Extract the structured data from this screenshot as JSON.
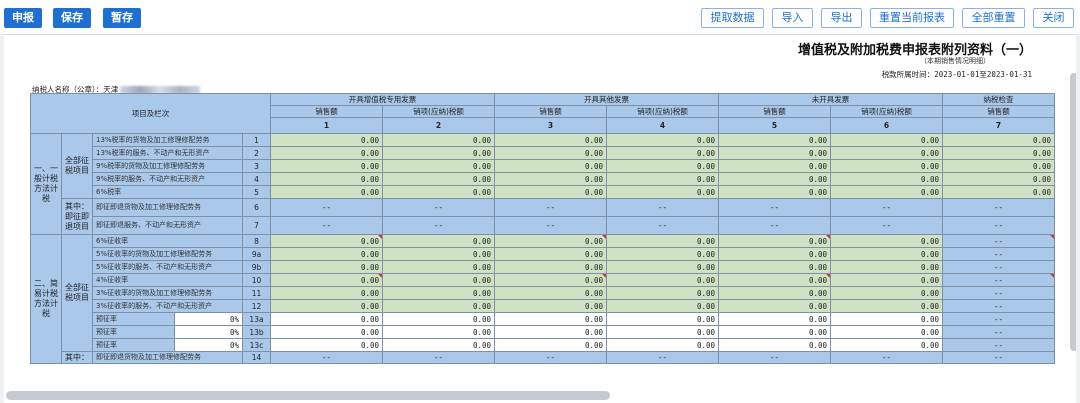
{
  "toolbar": {
    "declare": "申报",
    "save": "保存",
    "temp_save": "暂存",
    "fetch": "提取数据",
    "import": "导入",
    "export": "导出",
    "reset_current": "重置当前报表",
    "reset_all": "全部重置",
    "close": "关闭"
  },
  "report": {
    "title": "增值税及附加税费申报表附列资料（一）",
    "subtitle": "（本期销售情况明细）",
    "period_label": "税款所属时间：",
    "period_value": "2023-01-01至2023-01-31",
    "taxpayer_label": "纳税人名称（公章）：天津"
  },
  "table": {
    "item_header": "项目及栏次",
    "groups": [
      "开具增值税专用发票",
      "开具其他发票",
      "未开具发票",
      "纳税检查"
    ],
    "sub_sales": "销售额",
    "sub_tax": "销项(应纳)税额",
    "col_nums": [
      "1",
      "2",
      "3",
      "4",
      "5",
      "6",
      "7"
    ],
    "sec1": "一、一般计税方法计税",
    "sec2": "二、简易计税方法计税",
    "sub_all": "全部征税项目",
    "sub_refund": "其中：即征即退项目",
    "sub_refund_short": "其中：",
    "zero": "0.00",
    "dash": "--",
    "rate_pct": "0%",
    "rows": [
      {
        "label": "13%税率的货物及加工修理修配劳务",
        "ln": "1"
      },
      {
        "label": "13%税率的服务、不动产和无形资产",
        "ln": "2"
      },
      {
        "label": "9%税率的货物及加工修理修配劳务",
        "ln": "3"
      },
      {
        "label": "9%税率的服务、不动产和无形资产",
        "ln": "4"
      },
      {
        "label": "6%税率",
        "ln": "5"
      },
      {
        "label": "即征即退货物及加工修理修配劳务",
        "ln": "6"
      },
      {
        "label": "即征即退服务、不动产和无形资产",
        "ln": "7"
      },
      {
        "label": "6%征收率",
        "ln": "8"
      },
      {
        "label": "5%征收率的货物及加工修理修配劳务",
        "ln": "9a"
      },
      {
        "label": "5%征收率的服务、不动产和无形资产",
        "ln": "9b"
      },
      {
        "label": "4%征收率",
        "ln": "10"
      },
      {
        "label": "3%征收率的货物及加工修理修配劳务",
        "ln": "11"
      },
      {
        "label": "3%征收率的服务、不动产和无形资产",
        "ln": "12"
      },
      {
        "label": "预征率",
        "ln": "13a"
      },
      {
        "label": "预征率",
        "ln": "13b"
      },
      {
        "label": "预征率",
        "ln": "13c"
      },
      {
        "label": "即征即退货物及加工修理修配劳务",
        "ln": "14"
      }
    ]
  }
}
